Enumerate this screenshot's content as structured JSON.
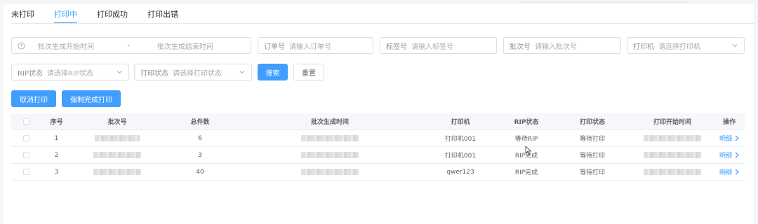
{
  "tabs": [
    {
      "label": "未打印",
      "active": false
    },
    {
      "label": "打印中",
      "active": true
    },
    {
      "label": "打印成功",
      "active": false
    },
    {
      "label": "打印出错",
      "active": false
    }
  ],
  "filters": {
    "date_start_placeholder": "批次生成开始时间",
    "date_separator": "-",
    "date_end_placeholder": "批次生成结束时间",
    "order_label": "订单号",
    "order_placeholder": "请输入订单号",
    "tag_label": "标签号",
    "tag_placeholder": "请输入标签号",
    "batch_label": "批次号",
    "batch_placeholder": "请输入批次号",
    "printer_label": "打印机",
    "printer_placeholder": "请选择打印机",
    "rip_label": "RIP状态",
    "rip_placeholder": "请选择RIP状态",
    "print_status_label": "打印状态",
    "print_status_placeholder": "请选择打印状态",
    "search_label": "搜索",
    "reset_label": "重置"
  },
  "actions": {
    "cancel_print": "取消打印",
    "force_complete": "强制完成打印"
  },
  "table": {
    "headers": [
      "序号",
      "批次号",
      "总件数",
      "批次生成时间",
      "打印机",
      "RIP状态",
      "打印状态",
      "打印开始时间",
      "操作"
    ],
    "rows": [
      {
        "index": "1",
        "total": "6",
        "printer": "打印机001",
        "rip": "等待RIP",
        "status": "等待打印",
        "action": "明细"
      },
      {
        "index": "2",
        "total": "3",
        "printer": "打印机001",
        "rip": "RIP完成",
        "status": "等待打印",
        "action": "明细"
      },
      {
        "index": "3",
        "total": "40",
        "printer": "qwer123",
        "rip": "RIP完成",
        "status": "等待打印",
        "action": "明细"
      }
    ]
  },
  "colors": {
    "primary": "#409eff",
    "border": "#dcdfe6",
    "header_bg": "#f5f7fa"
  }
}
